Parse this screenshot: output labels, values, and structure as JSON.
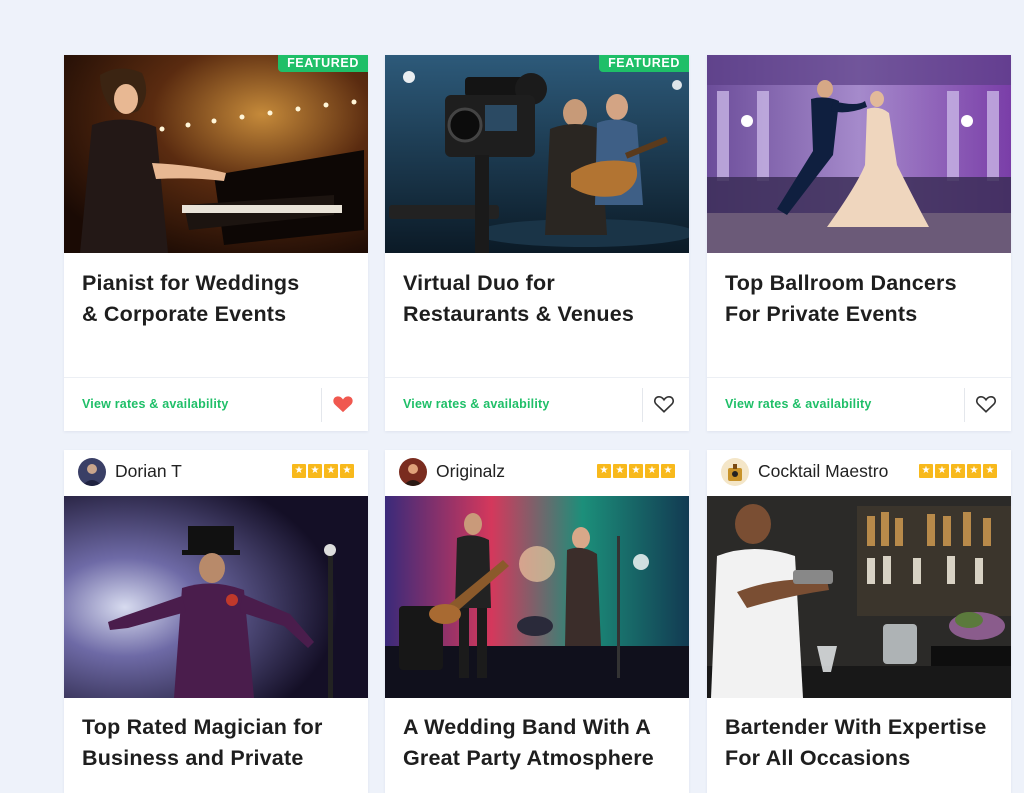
{
  "cards_top": [
    {
      "badge": "FEATURED",
      "title_line1": "Pianist for Weddings",
      "title_line2": "& Corporate Events",
      "link": "View rates & availability",
      "favorited": true
    },
    {
      "badge": "FEATURED",
      "title_line1": "Virtual Duo for",
      "title_line2": "Restaurants & Venues",
      "link": "View rates & availability",
      "favorited": false
    },
    {
      "badge": "",
      "title_line1": "Top Ballroom Dancers",
      "title_line2": "For Private Events",
      "link": "View rates & availability",
      "favorited": false
    }
  ],
  "cards_bottom": [
    {
      "performer": "Dorian T",
      "rating": 4,
      "title_line1": "Top Rated Magician for",
      "title_line2": "Business and Private"
    },
    {
      "performer": "Originalz",
      "rating": 5,
      "title_line1": "A Wedding Band With A",
      "title_line2": "Great Party Atmosphere"
    },
    {
      "performer": "Cocktail Maestro",
      "rating": 5,
      "title_line1": "Bartender With Expertise",
      "title_line2": "For All Occasions"
    }
  ],
  "colors": {
    "accent": "#1fbf68",
    "heart_active": "#f0584f",
    "star": "#f8b91c",
    "background": "#eef2fa"
  },
  "icons": {
    "favorite": "heart-icon",
    "rating": "star-icon"
  }
}
